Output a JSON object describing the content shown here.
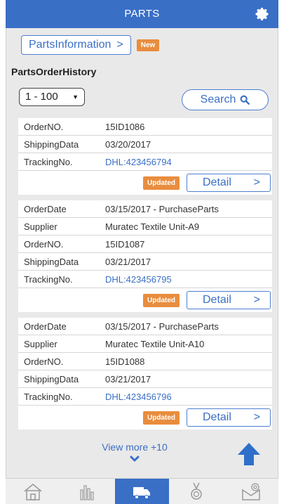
{
  "header": {
    "title": "PARTS"
  },
  "parts_info": {
    "label": "PartsInformation",
    "chevron": ">",
    "badge": "New"
  },
  "section_title": "PartsOrderHistory",
  "range": {
    "selected": "1 - 100"
  },
  "search": {
    "label": "Search"
  },
  "labels": {
    "order_date": "OrderDate",
    "supplier": "Supplier",
    "order_no": "OrderNO.",
    "shipping": "ShippingData",
    "tracking": "TrackingNo."
  },
  "partial_order": {
    "order_no": "15ID1086",
    "shipping": "03/20/2017",
    "tracking": "DHL:423456794",
    "badge": "Updated",
    "detail": "Detail",
    "detail_chevron": ">"
  },
  "orders": [
    {
      "order_date": "03/15/2017 - PurchaseParts",
      "supplier": "Muratec Textile Unit-A9",
      "order_no": "15ID1087",
      "shipping": "03/21/2017",
      "tracking": "DHL:423456795",
      "badge": "Updated",
      "detail": "Detail",
      "detail_chevron": ">"
    },
    {
      "order_date": "03/15/2017 - PurchaseParts",
      "supplier": "Muratec Textile Unit-A10",
      "order_no": "15ID1088",
      "shipping": "03/21/2017",
      "tracking": "DHL:423456796",
      "badge": "Updated",
      "detail": "Detail",
      "detail_chevron": ">"
    }
  ],
  "view_more": {
    "label": "View more +10"
  },
  "tabbar": {
    "items": [
      "home-icon",
      "bar-chart-icon",
      "truck-icon",
      "medal-icon",
      "settings-envelope-icon"
    ],
    "active": "truck-icon"
  },
  "colors": {
    "primary": "#3a6fc6",
    "badge": "#e98d3e",
    "background": "#e9e9e9"
  }
}
